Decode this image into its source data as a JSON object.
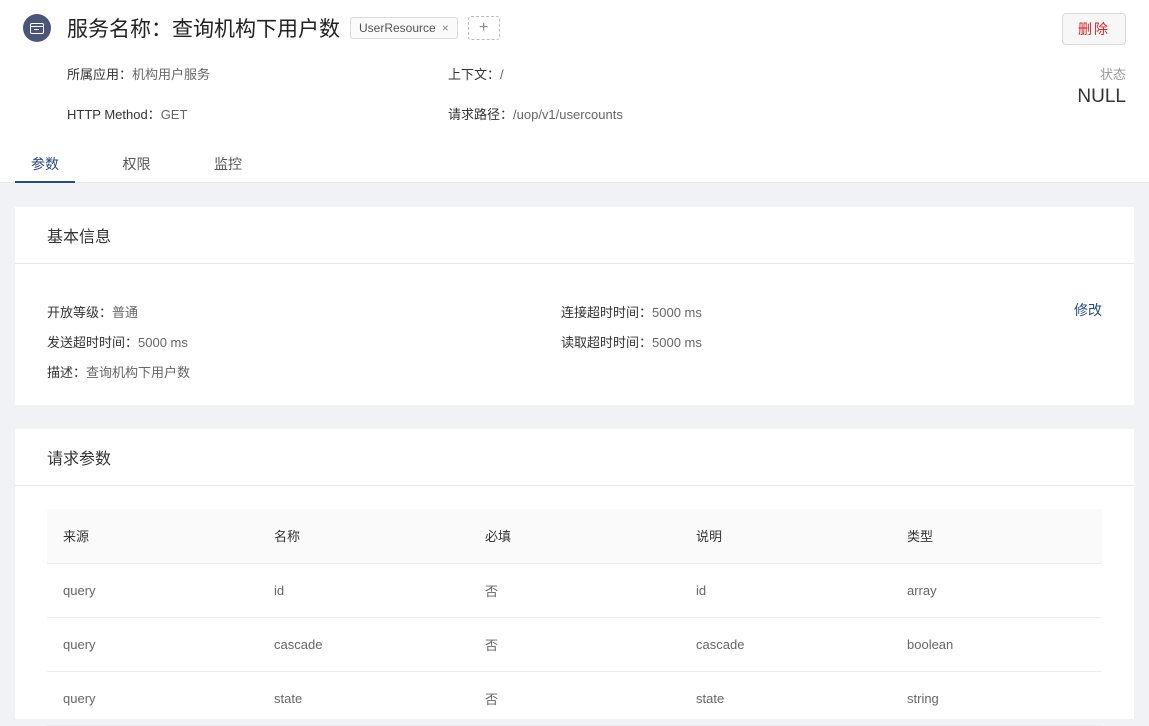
{
  "header": {
    "title": "服务名称：查询机构下用户数",
    "tag": "UserResource",
    "tag_close": "×",
    "add_tag": "+",
    "delete_label": "删除",
    "app_label": "所属应用：",
    "app_value": "机构用户服务",
    "context_label": "上下文：",
    "context_value": "/",
    "method_label": "HTTP Method：",
    "method_value": "GET",
    "path_label": "请求路径：",
    "path_value": "/uop/v1/usercounts",
    "status_label": "状态",
    "status_value": "NULL"
  },
  "tabs": [
    {
      "label": "参数"
    },
    {
      "label": "权限"
    },
    {
      "label": "监控"
    }
  ],
  "basic_info": {
    "title": "基本信息",
    "level_label": "开放等级：",
    "level_value": "普通",
    "connect_timeout_label": "连接超时时间：",
    "connect_timeout_value": "5000 ms",
    "send_timeout_label": "发送超时时间：",
    "send_timeout_value": "5000 ms",
    "read_timeout_label": "读取超时时间：",
    "read_timeout_value": "5000 ms",
    "desc_label": "描述：",
    "desc_value": "查询机构下用户数",
    "edit_label": "修改"
  },
  "request_params": {
    "title": "请求参数",
    "columns": [
      "来源",
      "名称",
      "必填",
      "说明",
      "类型"
    ],
    "rows": [
      [
        "query",
        "id",
        "否",
        "id",
        "array"
      ],
      [
        "query",
        "cascade",
        "否",
        "cascade",
        "boolean"
      ],
      [
        "query",
        "state",
        "否",
        "state",
        "string"
      ]
    ]
  }
}
